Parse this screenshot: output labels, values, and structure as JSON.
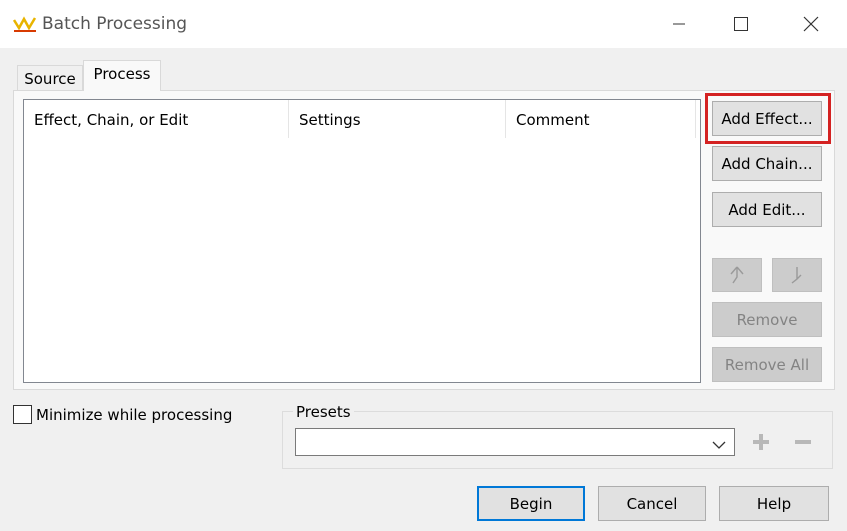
{
  "window": {
    "title": "Batch Processing"
  },
  "tabs": [
    {
      "label": "Source"
    },
    {
      "label": "Process"
    }
  ],
  "list": {
    "columns": [
      "Effect, Chain, or Edit",
      "Settings",
      "Comment"
    ],
    "rows": []
  },
  "side_buttons": {
    "add_effect": "Add Effect...",
    "add_chain": "Add Chain...",
    "add_edit": "Add Edit...",
    "remove": "Remove",
    "remove_all": "Remove All"
  },
  "options": {
    "minimize_label": "Minimize while processing",
    "minimize_checked": false
  },
  "presets": {
    "label": "Presets",
    "selected": ""
  },
  "footer": {
    "begin": "Begin",
    "cancel": "Cancel",
    "help": "Help"
  },
  "icons": {
    "app": "waveform-icon",
    "move_up": "arrow-up-icon",
    "move_down": "arrow-down-icon",
    "preset_add": "plus-icon",
    "preset_remove": "minus-icon"
  },
  "colors": {
    "highlight": "#d42222",
    "default_button_border": "#0078d7",
    "app_icon_yellow": "#e8b400",
    "app_icon_red": "#d83b01"
  }
}
